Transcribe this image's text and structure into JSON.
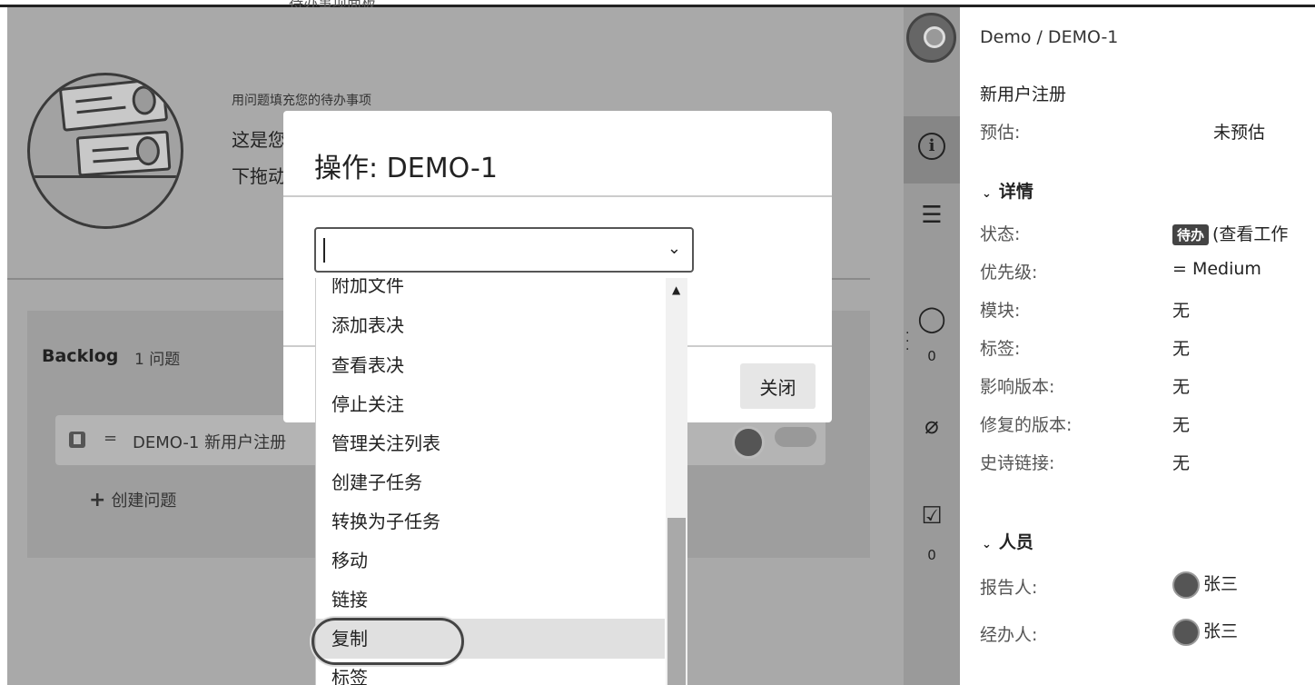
{
  "top": {
    "cut_text": "待办事项面板"
  },
  "intro": {
    "title": "用问题填充您的待办事项",
    "line1": "这是您",
    "line2": "下拖动"
  },
  "backlog": {
    "title": "Backlog",
    "count": "1 问题",
    "issue": {
      "priority_glyph": "=",
      "text": "DEMO-1 新用户注册"
    },
    "create_label": "创建问题",
    "create_plus": "+"
  },
  "modal": {
    "title": "操作: DEMO-1",
    "select_value": "",
    "chevron": "⌄",
    "close_label": "关闭",
    "options": [
      "附加文件",
      "添加表决",
      "查看表决",
      "停止关注",
      "管理关注列表",
      "创建子任务",
      "转换为子任务",
      "移动",
      "链接",
      "复制",
      "标签"
    ],
    "highlighted_option": "复制",
    "scroll_up": "▲"
  },
  "sidebar_icons": {
    "comment_count": "0",
    "checklist_count": "0",
    "info_glyph": "i",
    "menu_glyph": "☰",
    "comment_glyph": "◯",
    "clip_glyph": "⌀",
    "check_glyph": "☑"
  },
  "detail": {
    "breadcrumb": "Demo / DEMO-1",
    "summary": "新用户注册",
    "estimate_label": "预估:",
    "estimate_value": "未预估",
    "details_section": "详情",
    "people_section": "人员",
    "caret": "⌄",
    "fields": [
      {
        "label": "状态:",
        "value": "(查看工作"
      },
      {
        "label": "优先级:",
        "value": "= Medium"
      },
      {
        "label": "模块:",
        "value": "无"
      },
      {
        "label": "标签:",
        "value": "无"
      },
      {
        "label": "影响版本:",
        "value": "无"
      },
      {
        "label": "修复的版本:",
        "value": "无"
      },
      {
        "label": "史诗链接:",
        "value": "无"
      }
    ],
    "status_badge": "待办",
    "reporter_label": "报告人:",
    "reporter": "张三",
    "assignee_label": "经办人:",
    "assignee": "张三"
  }
}
